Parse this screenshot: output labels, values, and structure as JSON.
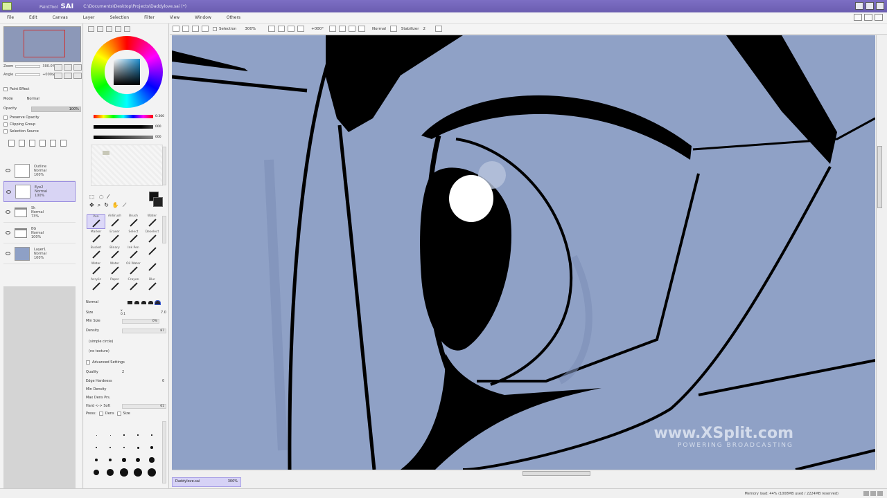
{
  "window": {
    "app_prefix": "PaintTool",
    "app_name": "SAI",
    "path": "C:\\Documents\\Desktop\\Projects\\Daddylove.sai (*)"
  },
  "menu": [
    "File",
    "Edit",
    "Canvas",
    "Layer",
    "Selection",
    "Filter",
    "View",
    "Window",
    "Others"
  ],
  "navigator": {
    "zoom_label": "Zoom",
    "zoom_value": "300.0%",
    "angle_label": "Angle",
    "angle_value": "+000$"
  },
  "layer_props": {
    "effect_label": "Paint Effect",
    "mode_label": "Mode",
    "mode_value": "Normal",
    "opacity_label": "Opacity",
    "opacity_value": "100%",
    "preserve_opacity": "Preserve Opacity",
    "clipping_group": "Clipping Group",
    "selection_source": "Selection Source"
  },
  "layers": [
    {
      "name": "Outline",
      "mode": "Normal",
      "opacity": "100%",
      "kind": "layer",
      "selected": false
    },
    {
      "name": "Eye2",
      "mode": "Normal",
      "opacity": "100%",
      "kind": "layer",
      "selected": true
    },
    {
      "name": "Sk",
      "mode": "Normal",
      "opacity": "73%",
      "kind": "folder",
      "selected": false
    },
    {
      "name": "BG",
      "mode": "Normal",
      "opacity": "100%",
      "kind": "folder",
      "selected": false
    },
    {
      "name": "Layer1",
      "mode": "Normal",
      "opacity": "100%",
      "kind": "blue",
      "selected": false
    }
  ],
  "color_sliders": {
    "hue_value": "0:360",
    "s_value": "000",
    "v_value": "000"
  },
  "tools": [
    {
      "label": "Pen",
      "active": true
    },
    {
      "label": "AirBrush",
      "active": false
    },
    {
      "label": "Brush",
      "active": false
    },
    {
      "label": "Water",
      "active": false
    },
    {
      "label": "Marker",
      "active": false
    },
    {
      "label": "Eraser",
      "active": false
    },
    {
      "label": "Select",
      "active": false
    },
    {
      "label": "Deselect",
      "active": false
    },
    {
      "label": "Bucket",
      "active": false
    },
    {
      "label": "Binary",
      "active": false
    },
    {
      "label": "Ink Pen",
      "active": false
    },
    {
      "label": "",
      "active": false
    },
    {
      "label": "Water",
      "active": false
    },
    {
      "label": "Water",
      "active": false
    },
    {
      "label": "Oil Water",
      "active": false
    },
    {
      "label": "",
      "active": false
    },
    {
      "label": "Acrylic",
      "active": false
    },
    {
      "label": "Paper",
      "active": false
    },
    {
      "label": "Crayon",
      "active": false
    },
    {
      "label": "Blur",
      "active": false
    }
  ],
  "brush": {
    "mode_label": "Normal",
    "size_label": "Size",
    "size_mult": "x 0.1",
    "size_value": "7.0",
    "min_size_label": "Min Size",
    "min_size_value": "0%",
    "density_label": "Density",
    "density_value": "87",
    "shape_label": "(simple circle)",
    "texture_label": "(no texture)",
    "advanced_label": "Advanced Settings",
    "quality_label": "Quality",
    "quality_value": "2",
    "edge_label": "Edge Hardness",
    "edge_value": "0",
    "min_density_label": "Min Density",
    "max_dens_label": "Max Dens Prs.",
    "hard_soft_label": "Hard <-> Soft",
    "hard_soft_value": "61",
    "press_label": "Press:",
    "press_dens": "Dens",
    "press_size": "Size"
  },
  "brush_sizes": [
    "1",
    "1.5",
    "2",
    "2.3",
    "2.6",
    "3",
    "3.5",
    "4",
    "5",
    "6",
    "7",
    "8",
    "9",
    "10",
    "12",
    "14",
    "16",
    "20",
    "25",
    "30"
  ],
  "canvas_toolbar": {
    "selection_label": "Selection",
    "zoom": "300%",
    "angle": "+000°",
    "mode": "Normal",
    "stabilizer_label": "Stabilizer",
    "stabilizer_value": "2"
  },
  "doc_tab": {
    "name": "Daddylove.sai",
    "zoom": "300%"
  },
  "status": {
    "memory": "Memory load: 44% (1008MB used / 2224MB reserved)"
  },
  "watermark": {
    "main": "www.XSplit.com",
    "sub": "POWERING BROADCASTING"
  }
}
